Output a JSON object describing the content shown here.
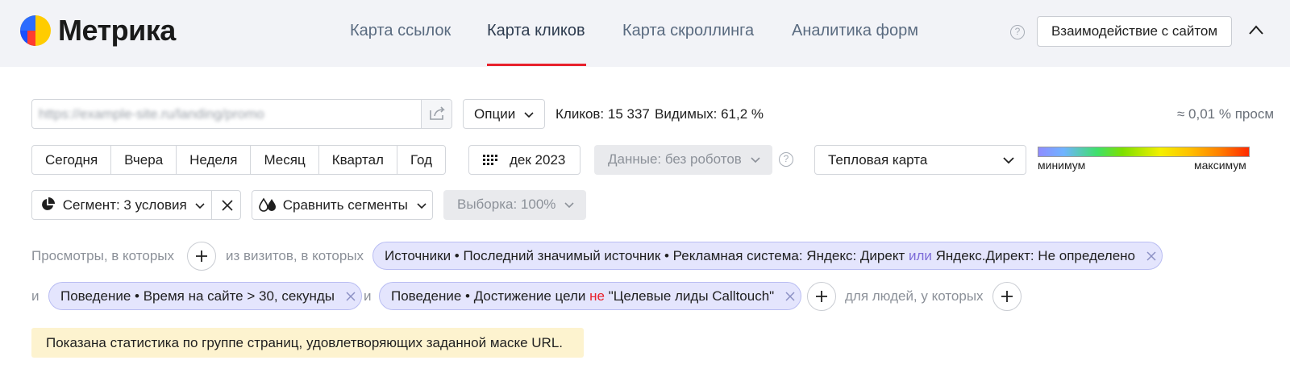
{
  "header": {
    "brand": "Метрика",
    "tabs": [
      {
        "label": "Карта ссылок"
      },
      {
        "label": "Карта кликов",
        "active": true
      },
      {
        "label": "Карта скроллинга"
      },
      {
        "label": "Аналитика форм"
      }
    ],
    "help": "?",
    "site_interaction_button": "Взаимодействие с сайтом",
    "accent_color": "#e8212c"
  },
  "toolbar": {
    "url_value": "https://example-site.ru/landing/promo",
    "options_label": "Опции",
    "clicks_text": "Кликов: 15 337",
    "visible_text": "Видимых: 61,2 %",
    "share_text": "≈ 0,01 % просм"
  },
  "period": {
    "items": [
      "Сегодня",
      "Вчера",
      "Неделя",
      "Месяц",
      "Квартал",
      "Год"
    ],
    "date_label": "дек 2023",
    "data_filter": "Данные: без роботов",
    "help": "?"
  },
  "heatmap": {
    "mode": "Тепловая карта",
    "min_label": "минимум",
    "max_label": "максимум"
  },
  "segment": {
    "label": "Сегмент: 3 условия",
    "compare_label": "Сравнить сегменты",
    "sample_label": "Выборка: 100%"
  },
  "conditions": {
    "views_prefix": "Просмотры, в которых",
    "visits_prefix": "из визитов, в которых",
    "chip1_text": "Источники • Последний значимый источник • Рекламная система: Яндекс: Директ",
    "chip1_or": "или",
    "chip1_tail": "Яндекс.Директ: Не определено",
    "and1": "и",
    "chip2_text": "Поведение • Время на сайте > 30, секунды",
    "and2": "и",
    "chip3_text": "Поведение • Достижение цели",
    "chip3_not": "не",
    "chip3_tail": "\"Целевые лиды Calltouch\"",
    "people_prefix": "для людей, у которых"
  },
  "notice": "Показана статистика по группе страниц, удовлетворяющих заданной маске URL."
}
